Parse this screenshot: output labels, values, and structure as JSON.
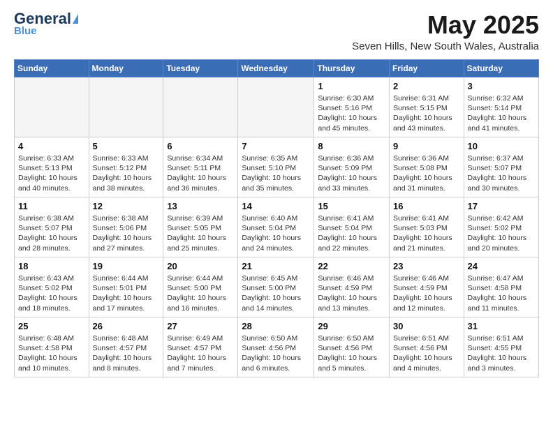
{
  "logo": {
    "general": "General",
    "blue": "Blue"
  },
  "title": "May 2025",
  "location": "Seven Hills, New South Wales, Australia",
  "days_of_week": [
    "Sunday",
    "Monday",
    "Tuesday",
    "Wednesday",
    "Thursday",
    "Friday",
    "Saturday"
  ],
  "weeks": [
    [
      {
        "day": "",
        "info": ""
      },
      {
        "day": "",
        "info": ""
      },
      {
        "day": "",
        "info": ""
      },
      {
        "day": "",
        "info": ""
      },
      {
        "day": "1",
        "info": "Sunrise: 6:30 AM\nSunset: 5:16 PM\nDaylight: 10 hours\nand 45 minutes."
      },
      {
        "day": "2",
        "info": "Sunrise: 6:31 AM\nSunset: 5:15 PM\nDaylight: 10 hours\nand 43 minutes."
      },
      {
        "day": "3",
        "info": "Sunrise: 6:32 AM\nSunset: 5:14 PM\nDaylight: 10 hours\nand 41 minutes."
      }
    ],
    [
      {
        "day": "4",
        "info": "Sunrise: 6:33 AM\nSunset: 5:13 PM\nDaylight: 10 hours\nand 40 minutes."
      },
      {
        "day": "5",
        "info": "Sunrise: 6:33 AM\nSunset: 5:12 PM\nDaylight: 10 hours\nand 38 minutes."
      },
      {
        "day": "6",
        "info": "Sunrise: 6:34 AM\nSunset: 5:11 PM\nDaylight: 10 hours\nand 36 minutes."
      },
      {
        "day": "7",
        "info": "Sunrise: 6:35 AM\nSunset: 5:10 PM\nDaylight: 10 hours\nand 35 minutes."
      },
      {
        "day": "8",
        "info": "Sunrise: 6:36 AM\nSunset: 5:09 PM\nDaylight: 10 hours\nand 33 minutes."
      },
      {
        "day": "9",
        "info": "Sunrise: 6:36 AM\nSunset: 5:08 PM\nDaylight: 10 hours\nand 31 minutes."
      },
      {
        "day": "10",
        "info": "Sunrise: 6:37 AM\nSunset: 5:07 PM\nDaylight: 10 hours\nand 30 minutes."
      }
    ],
    [
      {
        "day": "11",
        "info": "Sunrise: 6:38 AM\nSunset: 5:07 PM\nDaylight: 10 hours\nand 28 minutes."
      },
      {
        "day": "12",
        "info": "Sunrise: 6:38 AM\nSunset: 5:06 PM\nDaylight: 10 hours\nand 27 minutes."
      },
      {
        "day": "13",
        "info": "Sunrise: 6:39 AM\nSunset: 5:05 PM\nDaylight: 10 hours\nand 25 minutes."
      },
      {
        "day": "14",
        "info": "Sunrise: 6:40 AM\nSunset: 5:04 PM\nDaylight: 10 hours\nand 24 minutes."
      },
      {
        "day": "15",
        "info": "Sunrise: 6:41 AM\nSunset: 5:04 PM\nDaylight: 10 hours\nand 22 minutes."
      },
      {
        "day": "16",
        "info": "Sunrise: 6:41 AM\nSunset: 5:03 PM\nDaylight: 10 hours\nand 21 minutes."
      },
      {
        "day": "17",
        "info": "Sunrise: 6:42 AM\nSunset: 5:02 PM\nDaylight: 10 hours\nand 20 minutes."
      }
    ],
    [
      {
        "day": "18",
        "info": "Sunrise: 6:43 AM\nSunset: 5:02 PM\nDaylight: 10 hours\nand 18 minutes."
      },
      {
        "day": "19",
        "info": "Sunrise: 6:44 AM\nSunset: 5:01 PM\nDaylight: 10 hours\nand 17 minutes."
      },
      {
        "day": "20",
        "info": "Sunrise: 6:44 AM\nSunset: 5:00 PM\nDaylight: 10 hours\nand 16 minutes."
      },
      {
        "day": "21",
        "info": "Sunrise: 6:45 AM\nSunset: 5:00 PM\nDaylight: 10 hours\nand 14 minutes."
      },
      {
        "day": "22",
        "info": "Sunrise: 6:46 AM\nSunset: 4:59 PM\nDaylight: 10 hours\nand 13 minutes."
      },
      {
        "day": "23",
        "info": "Sunrise: 6:46 AM\nSunset: 4:59 PM\nDaylight: 10 hours\nand 12 minutes."
      },
      {
        "day": "24",
        "info": "Sunrise: 6:47 AM\nSunset: 4:58 PM\nDaylight: 10 hours\nand 11 minutes."
      }
    ],
    [
      {
        "day": "25",
        "info": "Sunrise: 6:48 AM\nSunset: 4:58 PM\nDaylight: 10 hours\nand 10 minutes."
      },
      {
        "day": "26",
        "info": "Sunrise: 6:48 AM\nSunset: 4:57 PM\nDaylight: 10 hours\nand 8 minutes."
      },
      {
        "day": "27",
        "info": "Sunrise: 6:49 AM\nSunset: 4:57 PM\nDaylight: 10 hours\nand 7 minutes."
      },
      {
        "day": "28",
        "info": "Sunrise: 6:50 AM\nSunset: 4:56 PM\nDaylight: 10 hours\nand 6 minutes."
      },
      {
        "day": "29",
        "info": "Sunrise: 6:50 AM\nSunset: 4:56 PM\nDaylight: 10 hours\nand 5 minutes."
      },
      {
        "day": "30",
        "info": "Sunrise: 6:51 AM\nSunset: 4:56 PM\nDaylight: 10 hours\nand 4 minutes."
      },
      {
        "day": "31",
        "info": "Sunrise: 6:51 AM\nSunset: 4:55 PM\nDaylight: 10 hours\nand 3 minutes."
      }
    ]
  ]
}
